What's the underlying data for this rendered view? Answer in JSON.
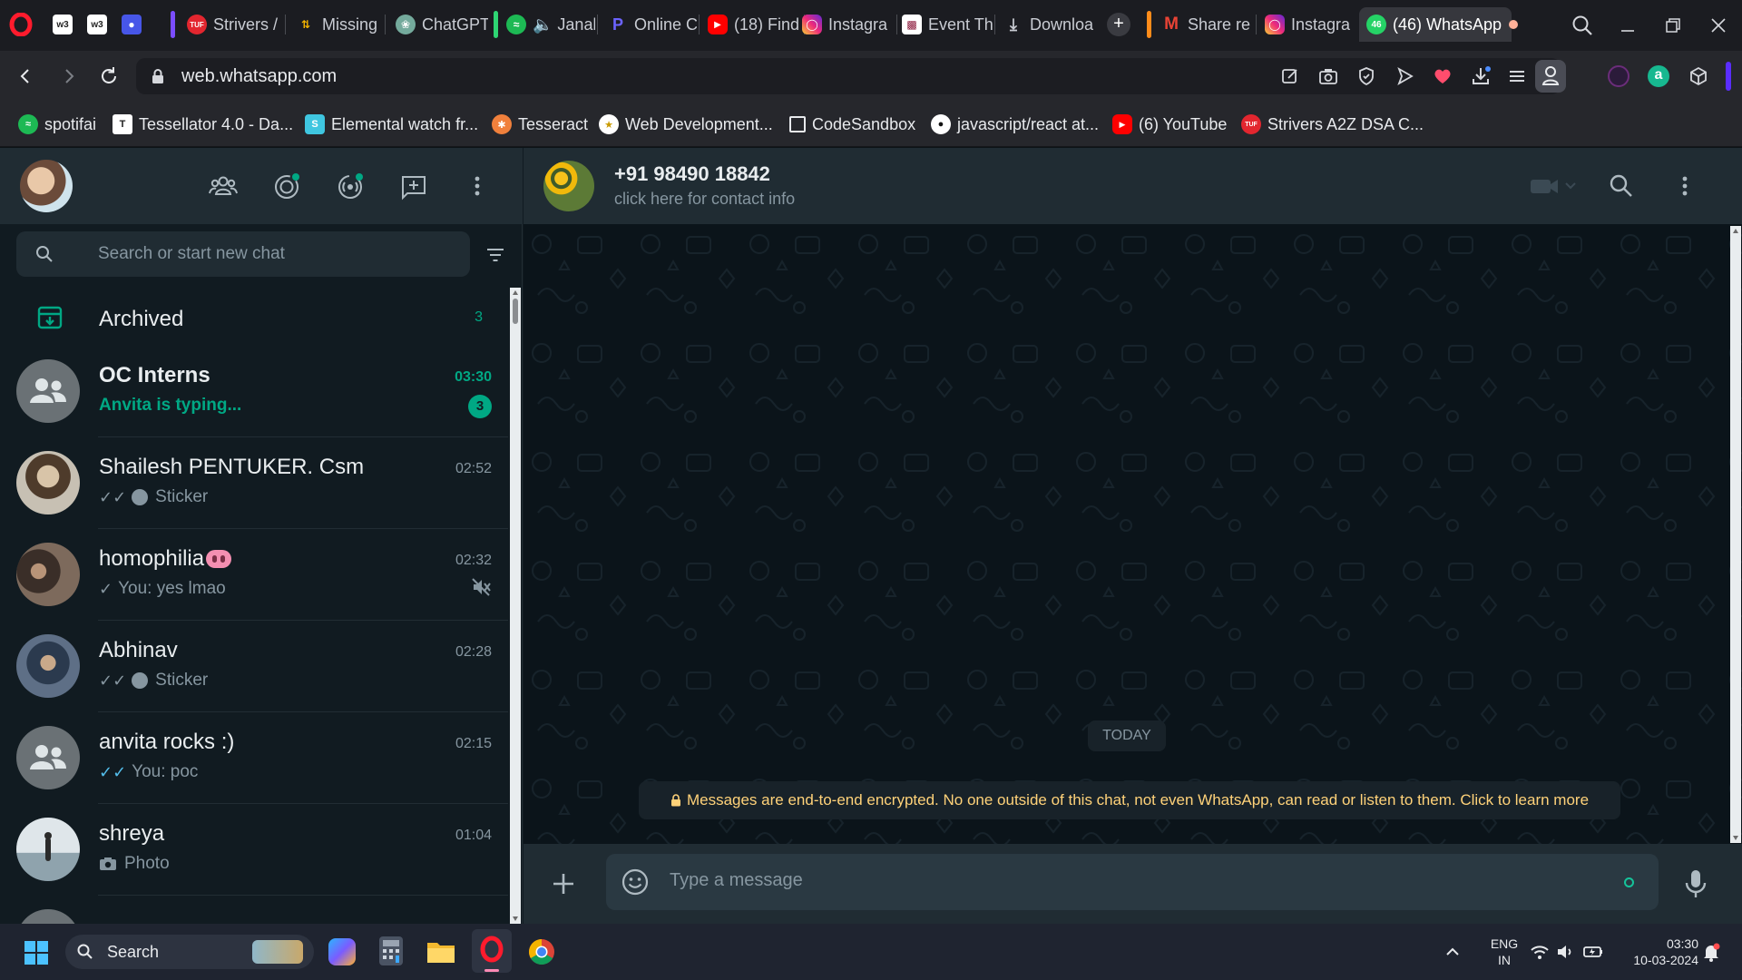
{
  "browser": {
    "tabs": [
      {
        "label": "",
        "icon": "w3schools-icon"
      },
      {
        "label": "",
        "icon": "w3schools-icon"
      },
      {
        "label": "",
        "icon": "bell-icon"
      },
      {
        "label": "Strivers /",
        "icon": "striver-icon"
      },
      {
        "label": "Missing",
        "icon": "sorting-icon"
      },
      {
        "label": "ChatGPT",
        "icon": "chatgpt-icon"
      },
      {
        "label": "Janal",
        "icon": "spotify-icon"
      },
      {
        "label": "Online C",
        "icon": "p-icon"
      },
      {
        "label": "(18) Find",
        "icon": "youtube-icon"
      },
      {
        "label": "Instagra",
        "icon": "instagram-icon"
      },
      {
        "label": "Event Th",
        "icon": "event-icon"
      },
      {
        "label": "Downloa",
        "icon": "download-icon"
      },
      {
        "label": "Share re",
        "icon": "gmail-icon"
      },
      {
        "label": "Instagra",
        "icon": "instagram-icon"
      },
      {
        "label": "(46) WhatsApp",
        "icon": "whatsapp-icon",
        "active": true,
        "badge": "46"
      }
    ],
    "url": "web.whatsapp.com",
    "bookmarks": [
      {
        "label": "spotifai",
        "icon": "spotify-icon"
      },
      {
        "label": "Tessellator 4.0 - Da...",
        "icon": "tessellator-icon"
      },
      {
        "label": "Elemental watch fr...",
        "icon": "s-icon"
      },
      {
        "label": "Tesseract",
        "icon": "tesseract-icon"
      },
      {
        "label": "Web Development...",
        "icon": "web-icon"
      },
      {
        "label": "CodeSandbox",
        "icon": "codesandbox-icon"
      },
      {
        "label": "javascript/react at...",
        "icon": "github-icon"
      },
      {
        "label": "(6) YouTube",
        "icon": "youtube-icon"
      },
      {
        "label": "Strivers A2Z DSA C...",
        "icon": "striver-icon"
      }
    ]
  },
  "whatsapp": {
    "search_placeholder": "Search or start new chat",
    "archived": {
      "label": "Archived",
      "count": "3"
    },
    "chats": [
      {
        "name": "OC Interns",
        "subtitle": "Anvita is typing...",
        "time": "03:30",
        "unread": "3",
        "typing": true,
        "avatar": "group"
      },
      {
        "name": "Shailesh PENTUKER. Csm",
        "subtitle": "Sticker",
        "time": "02:52",
        "ticks": "double",
        "sticker": true,
        "avatar": "photo"
      },
      {
        "name": "homophilia",
        "subtitle": "You: yes lmao",
        "time": "02:32",
        "ticks": "single",
        "muted": true,
        "avatar": "photo"
      },
      {
        "name": "Abhinav",
        "subtitle": "Sticker",
        "time": "02:28",
        "ticks": "double",
        "sticker": true,
        "avatar": "photo"
      },
      {
        "name": "anvita rocks :)",
        "subtitle": "You: poc",
        "time": "02:15",
        "ticks": "double-blue",
        "avatar": "group"
      },
      {
        "name": "shreya",
        "subtitle": "Photo",
        "time": "01:04",
        "photo": true,
        "avatar": "photo"
      }
    ],
    "contact": {
      "name": "+91 98490 18842",
      "subtitle": "click here for contact info"
    },
    "date_chip": "TODAY",
    "encryption_notice": "Messages are end-to-end encrypted. No one outside of this chat, not even WhatsApp, can read or listen to them. Click to learn more",
    "message_placeholder": "Type a message"
  },
  "taskbar": {
    "search_label": "Search",
    "lang_line1": "ENG",
    "lang_line2": "IN",
    "time": "03:30",
    "date": "10-03-2024"
  },
  "colors": {
    "accent": "#00a884",
    "encryption_text": "#ffd279",
    "panel": "#202c33",
    "chat_bg": "#0b141a"
  }
}
